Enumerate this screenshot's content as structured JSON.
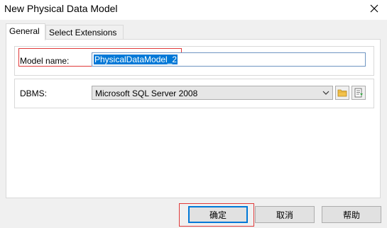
{
  "window": {
    "title": "New Physical Data Model"
  },
  "tabs": [
    {
      "label": "General",
      "active": true
    },
    {
      "label": "Select Extensions",
      "active": false
    }
  ],
  "form": {
    "model_name_label": "Model name:",
    "model_name_value": "PhysicalDataModel_2",
    "dbms_label": "DBMS:",
    "dbms_value": "Microsoft SQL Server 2008"
  },
  "buttons": {
    "ok": "确定",
    "cancel": "取消",
    "help": "帮助"
  },
  "colors": {
    "selection": "#0078d7",
    "highlight_box": "#e03a3a",
    "focus_border": "#0078d7"
  },
  "icons": {
    "close": "close-icon",
    "dropdown": "chevron-down-icon",
    "folder": "folder-icon",
    "properties": "properties-icon"
  }
}
